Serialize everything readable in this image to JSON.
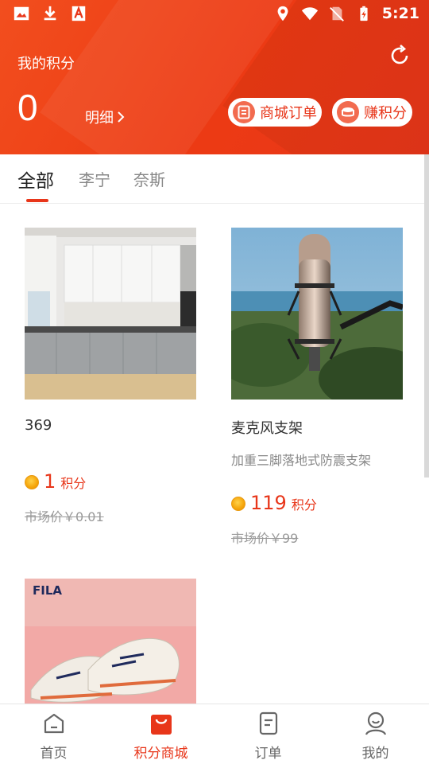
{
  "status_bar": {
    "time": "5:21"
  },
  "header": {
    "title": "我的积分",
    "points": "0",
    "detail_link": "明细",
    "orders_button": "商城订单",
    "earn_button": "赚积分"
  },
  "tabs": [
    {
      "label": "全部",
      "active": true
    },
    {
      "label": "李宁",
      "active": false
    },
    {
      "label": "奈斯",
      "active": false
    }
  ],
  "products": [
    {
      "name": "369",
      "desc": "",
      "points": "1",
      "unit": "积分",
      "market_price": "市场价￥0.01",
      "image": "kitchen-photo"
    },
    {
      "name": "麦克风支架",
      "desc": "加重三脚落地式防震支架",
      "points": "119",
      "unit": "积分",
      "market_price": "市场价￥99",
      "image": "microphone-photo"
    },
    {
      "name": "",
      "desc": "",
      "points": "",
      "unit": "",
      "market_price": "",
      "image": "sneaker-photo",
      "brand": "FILA"
    }
  ],
  "bottom_nav": [
    {
      "label": "首页",
      "icon": "home-icon",
      "active": false
    },
    {
      "label": "积分商城",
      "icon": "shopping-bag-icon",
      "active": true
    },
    {
      "label": "订单",
      "icon": "order-icon",
      "active": false
    },
    {
      "label": "我的",
      "icon": "user-icon",
      "active": false
    }
  ],
  "colors": {
    "accent": "#e8361a",
    "coin": "#f5a50a"
  }
}
